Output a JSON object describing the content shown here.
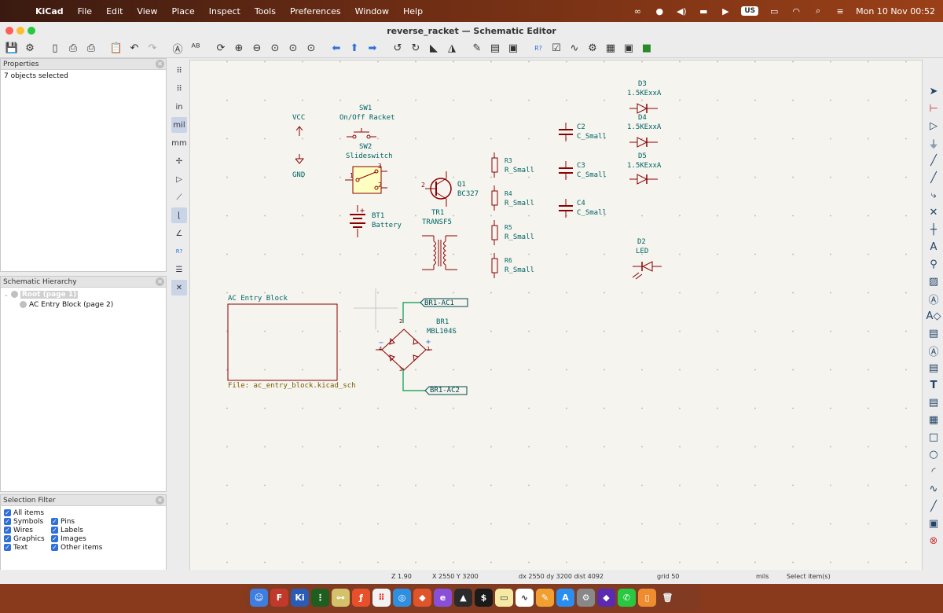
{
  "menubar": {
    "items": [
      "KiCad",
      "File",
      "Edit",
      "View",
      "Place",
      "Inspect",
      "Tools",
      "Preferences",
      "Window",
      "Help"
    ],
    "input_source": "US",
    "clock": "Mon 10 Nov  00:52"
  },
  "window": {
    "title": "reverse_racket — Schematic Editor"
  },
  "properties": {
    "title": "Properties",
    "selection": "7 objects selected"
  },
  "hierarchy": {
    "title": "Schematic Hierarchy",
    "items": [
      "Root (page 1)",
      "AC Entry Block (page 2)"
    ]
  },
  "selection_filter": {
    "title": "Selection Filter",
    "items": [
      "All items",
      "Symbols",
      "Pins",
      "Wires",
      "Labels",
      "Graphics",
      "Images",
      "Text",
      "Other items"
    ]
  },
  "left_tools": {
    "inch": "in",
    "mil": "mil",
    "mm": "mm"
  },
  "schematic": {
    "vcc": "VCC",
    "gnd": "GND",
    "sw1_ref": "SW1",
    "sw1_value": "On/Off Racket",
    "sw2_ref": "SW2",
    "sw2_value": "Slideswitch",
    "bt1_ref": "BT1",
    "bt1_value": "Battery",
    "q1_ref": "Q1",
    "q1_value": "BC327",
    "tr1_ref": "TR1",
    "tr1_value": "TRANSF5",
    "r3_ref": "R3",
    "r3_value": "R_Small",
    "r4_ref": "R4",
    "r4_value": "R_Small",
    "r5_ref": "R5",
    "r5_value": "R_Small",
    "r6_ref": "R6",
    "r6_value": "R_Small",
    "c2_ref": "C2",
    "c2_value": "C_Small",
    "c3_ref": "C3",
    "c3_value": "C_Small",
    "c4_ref": "C4",
    "c4_value": "C_Small",
    "d3_ref": "D3",
    "d3_value": "1.5KExxA",
    "d4_ref": "D4",
    "d4_value": "1.5KExxA",
    "d5_ref": "D5",
    "d5_value": "1.5KExxA",
    "d2_ref": "D2",
    "d2_value": "LED",
    "sheet_name": "AC Entry Block",
    "sheet_file": "File: ac_entry_block.kicad_sch",
    "br1_ref": "BR1",
    "br1_value": "MBL104S",
    "label_ac1": "BR1-AC1",
    "label_ac2": "BR1-AC2",
    "pin_1": "1",
    "pin_2": "2",
    "pin_3": "3",
    "pin_4": "4",
    "plus": "+",
    "minus": "−",
    "tilde": "~"
  },
  "statusbar": {
    "zoom": "Z 1.90",
    "xy": "X 2550  Y 3200",
    "delta": "dx 2550  dy 3200  dist 4092",
    "grid": "grid 50",
    "units": "mils",
    "mode": "Select item(s)"
  },
  "colors": {
    "symbol_body": "#8a0000",
    "symbol_fill": "#ffffc2",
    "text": "#006464",
    "wire": "#009a4a",
    "canvas": "#f5f4ef"
  }
}
